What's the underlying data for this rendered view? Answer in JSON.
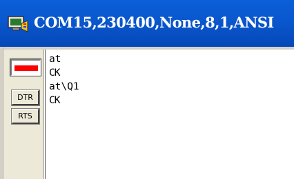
{
  "window": {
    "title": "COM15,230400,None,8,1,ANSI",
    "icon": "serial-terminal-app-icon"
  },
  "sidebar": {
    "indicator": {
      "icon": "status-lamp-icon",
      "color": "#ff0000"
    },
    "dtr_label": "DTR",
    "rts_label": "RTS"
  },
  "terminal": {
    "lines": [
      "at",
      "CK",
      "at\\Q1",
      "CK"
    ]
  },
  "colors": {
    "titlebar": "#0a58cf",
    "sidebar": "#ece9d8",
    "terminal_bg": "#ffffff"
  }
}
